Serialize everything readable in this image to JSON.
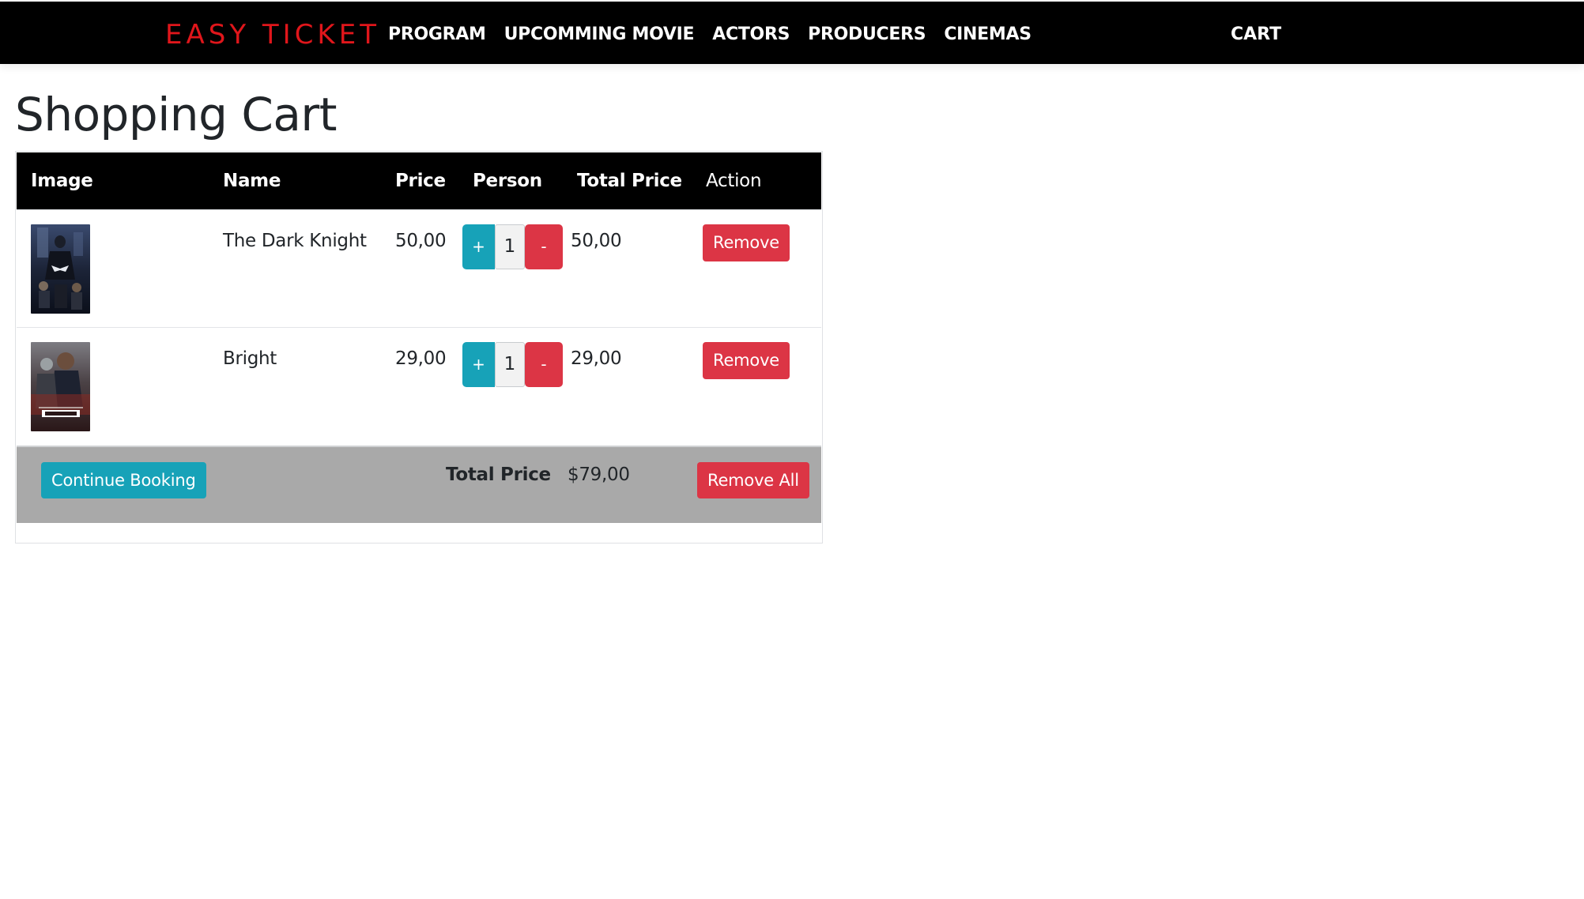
{
  "navbar": {
    "brand": "EASY TICKET",
    "links": [
      "PROGRAM",
      "UPCOMMING MOVIE",
      "ACTORS",
      "PRODUCERS",
      "CINEMAS"
    ],
    "cart": "CART",
    "brand_color": "#e0161b",
    "background": "#000000"
  },
  "page": {
    "title": "Shopping Cart"
  },
  "table": {
    "headers": {
      "image": "Image",
      "name": "Name",
      "price": "Price",
      "person": "Person",
      "total_price": "Total Price",
      "action": "Action"
    },
    "rows": [
      {
        "poster_icon": "dark-knight-poster",
        "name": "The Dark Knight",
        "price": "50,00",
        "plus": "+",
        "quantity": "1",
        "minus": "-",
        "total": "50,00",
        "remove": "Remove"
      },
      {
        "poster_icon": "bright-poster",
        "name": "Bright",
        "price": "29,00",
        "plus": "+",
        "quantity": "1",
        "minus": "-",
        "total": "29,00",
        "remove": "Remove"
      }
    ]
  },
  "footer": {
    "continue": "Continue Booking",
    "total_label": "Total Price",
    "total_value": "$79,00",
    "remove_all": "Remove All"
  },
  "colors": {
    "info": "#17a2b8",
    "danger": "#dc3545",
    "footer_bg": "#a9a9a9"
  }
}
